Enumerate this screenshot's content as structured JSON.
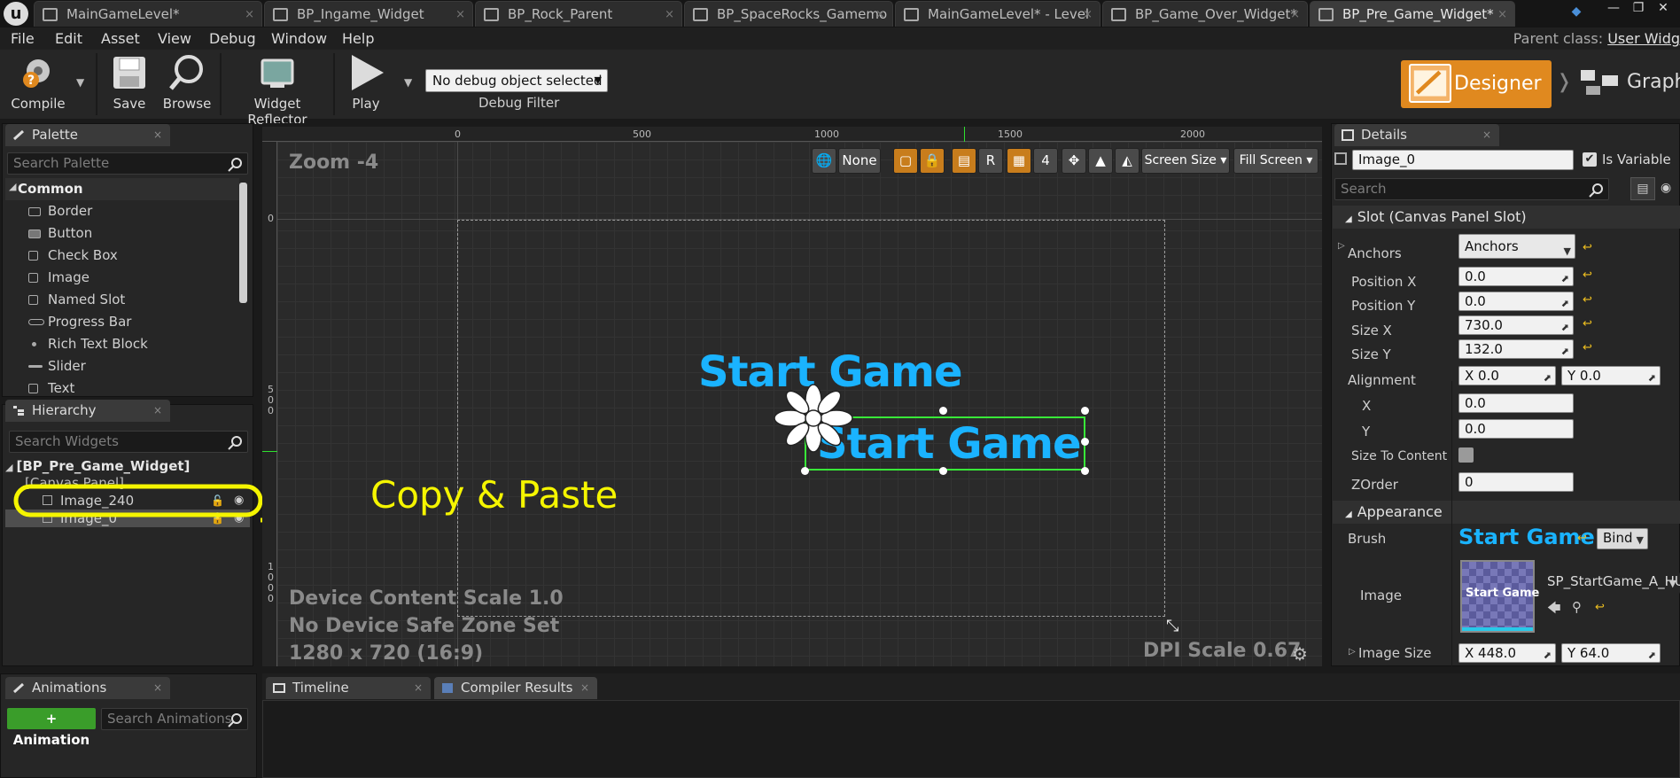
{
  "title_tabs": [
    {
      "label": "MainGameLevel*"
    },
    {
      "label": "BP_Ingame_Widget"
    },
    {
      "label": "BP_Rock_Parent"
    },
    {
      "label": "BP_SpaceRocks_Gamemo"
    },
    {
      "label": "MainGameLevel* - Level"
    },
    {
      "label": "BP_Game_Over_Widget*"
    },
    {
      "label": "BP_Pre_Game_Widget*"
    }
  ],
  "logo_letter": "u",
  "menu": [
    "File",
    "Edit",
    "Asset",
    "View",
    "Debug",
    "Window",
    "Help"
  ],
  "parent_class": {
    "label": "Parent class:",
    "value": "User Widg"
  },
  "toolbar": {
    "compile": "Compile",
    "save": "Save",
    "browse": "Browse",
    "widget_reflector": "Widget Reflector",
    "play": "Play",
    "debug_combo": "No debug object selected",
    "debug_filter": "Debug Filter"
  },
  "mode": {
    "designer": "Designer",
    "graph": "Graph"
  },
  "palette": {
    "tab": "Palette",
    "search_placeholder": "Search Palette",
    "category": "Common",
    "items": [
      "Border",
      "Button",
      "Check Box",
      "Image",
      "Named Slot",
      "Progress Bar",
      "Rich Text Block",
      "Slider",
      "Text"
    ]
  },
  "hierarchy": {
    "tab": "Hierarchy",
    "search_placeholder": "Search Widgets",
    "root": "[BP_Pre_Game_Widget]",
    "canvas": "[Canvas Panel]",
    "items": [
      "Image_240",
      "Image_0"
    ]
  },
  "viewport": {
    "zoom": "Zoom -4",
    "ruler_top": [
      "0",
      "500",
      "1000",
      "1500",
      "2000"
    ],
    "ruler_left_top": "0",
    "ruler_left_mid": "5\n0\n0",
    "ruler_left_bottom": "1\n0\n0\n0",
    "toolbar": {
      "none": "None",
      "r": "R",
      "grid_num": "4",
      "screen_size": "Screen Size",
      "fill_screen": "Fill Screen"
    },
    "device_scale": "Device Content Scale 1.0",
    "safe_zone": "No Device Safe Zone Set",
    "resolution": "1280 x 720 (16:9)",
    "dpi": "DPI Scale 0.67",
    "widget_text_1": "Start Game",
    "widget_text_2": "Start Game"
  },
  "annotation": {
    "text": "Copy & Paste",
    "color": "#f5f500"
  },
  "details": {
    "tab": "Details",
    "name": "Image_0",
    "is_variable": "Is Variable",
    "search_placeholder": "Search",
    "slot_section": "Slot (Canvas Panel Slot)",
    "anchors_label": "Anchors",
    "anchors_value": "Anchors",
    "position_x_label": "Position X",
    "position_x": "0.0",
    "position_y_label": "Position Y",
    "position_y": "0.0",
    "size_x_label": "Size X",
    "size_x": "730.0",
    "size_y_label": "Size Y",
    "size_y": "132.0",
    "alignment_label": "Alignment",
    "alignment_x": "X  0.0",
    "alignment_y": "Y  0.0",
    "x_label": "X",
    "x_value": "0.0",
    "y_label": "Y",
    "y_value": "0.0",
    "size_to_content_label": "Size To Content",
    "zorder_label": "ZOrder",
    "zorder": "0",
    "appearance_section": "Appearance",
    "brush_label": "Brush",
    "brush_preview_text": "Start Game",
    "bind": "Bind",
    "image_label": "Image",
    "image_asset": "SP_StartGame_A_HU",
    "thumb_text": "Start Game",
    "image_size_label": "Image Size",
    "image_size_x": "X  448.0",
    "image_size_y": "Y  64.0"
  },
  "animations": {
    "tab": "Animations",
    "add_button": "+ Animation",
    "search_placeholder": "Search Animations"
  },
  "bottom_tabs": [
    "Timeline",
    "Compiler Results"
  ],
  "colors": {
    "accent_orange": "#e0891f",
    "selection_green": "#38e838",
    "widget_blue": "#1ab3ff",
    "annotation_yellow": "#f5f500",
    "add_green": "#3a9d2a"
  }
}
